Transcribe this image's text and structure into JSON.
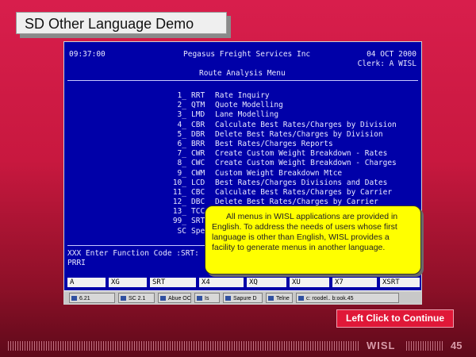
{
  "slide": {
    "title": "SD Other Language Demo",
    "continue_label": "Left Click to Continue",
    "brand": "WISL",
    "page_number": "45"
  },
  "terminal": {
    "time": "09:37:00",
    "company": "Pegasus Freight Services Inc",
    "date": "04 OCT 2000",
    "clerk": "Clerk: A WISL",
    "menu_title": "Route Analysis Menu",
    "menu_items": [
      {
        "num": "1_",
        "code": "RRT",
        "label": "Rate Inquiry"
      },
      {
        "num": "2_",
        "code": "QTM",
        "label": "Quote Modelling"
      },
      {
        "num": "3_",
        "code": "LMD",
        "label": "Lane Modelling"
      },
      {
        "num": "4_",
        "code": "CBR",
        "label": "Calculate Best Rates/Charges by Division"
      },
      {
        "num": "5_",
        "code": "DBR",
        "label": "Delete Best Rates/Charges by Division"
      },
      {
        "num": "6_",
        "code": "BRR",
        "label": "Best Rates/Charges Reports"
      },
      {
        "num": "7_",
        "code": "CWR",
        "label": "Create Custom Weight Breakdown - Rates"
      },
      {
        "num": "8_",
        "code": "CWC",
        "label": "Create Custom Weight Breakdown - Charges"
      },
      {
        "num": "9_",
        "code": "CWM",
        "label": "Custom Weight Breakdown Mtce"
      },
      {
        "num": "10_",
        "code": "LCD",
        "label": "Best Rates/Charges Divisions and Dates"
      },
      {
        "num": "11_",
        "code": "CBC",
        "label": "Calculate Best Rates/Charges by Carrier"
      },
      {
        "num": "12_",
        "code": "DBC",
        "label": "Delete Best Rates/Charges by Carrier"
      },
      {
        "num": "13_",
        "code": "TCC",
        "label": ""
      },
      {
        "num": "99_",
        "code": "SRT",
        "label": ""
      },
      {
        "num": "SC",
        "code": "Spe",
        "label": ""
      }
    ],
    "prompt": "XXX Enter Function Code :SRT:",
    "prompt_second": "PRRI",
    "function_keys": [
      "A",
      "XG",
      "SRT",
      "X4",
      "XQ",
      "XU",
      "X7",
      "XSRT"
    ],
    "taskbar_items": [
      "6.21",
      "SC 2.1",
      "Abue OC",
      "Is",
      "Sapure D",
      "Telne",
      "c: roodel.. b:ook.45"
    ]
  },
  "callout": {
    "text": "All menus in WISL applications are provided in English. To address the needs of users whose first language is other than English, WISL provides a facility to generate menus in another language."
  },
  "colors": {
    "background": "#c8183f",
    "terminal_bg": "#0000a8",
    "callout_bg": "#ffff00",
    "continue_bg": "#e01838"
  }
}
